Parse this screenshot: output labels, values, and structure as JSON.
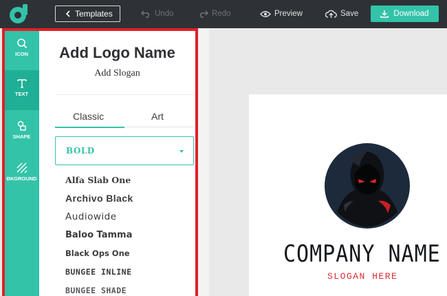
{
  "toolbar": {
    "templates_label": "Templates",
    "undo_label": "Undo",
    "redo_label": "Redo",
    "preview_label": "Preview",
    "save_label": "Save",
    "download_label": "Download"
  },
  "sidebar": {
    "items": [
      {
        "label": "ICON",
        "icon": "search-icon"
      },
      {
        "label": "TEXT",
        "icon": "text-icon"
      },
      {
        "label": "SHAPE",
        "icon": "shape-icon"
      },
      {
        "label": "BKGROUND",
        "icon": "background-icon"
      }
    ]
  },
  "panel": {
    "logo_name": "Add Logo Name",
    "slogan": "Add Slogan",
    "tabs": [
      {
        "label": "Classic"
      },
      {
        "label": "Art"
      }
    ],
    "font_category": "BOLD",
    "fonts": [
      "Alfa Slab One",
      "Archivo Black",
      "Audiowide",
      "Baloo Tamma",
      "Black Ops One",
      "BUNGEE INLINE",
      "BUNGEE SHADE"
    ]
  },
  "canvas": {
    "company_name": "COMPANY NAME",
    "slogan": "SLOGAN HERE"
  },
  "colors": {
    "accent": "#33c3a9",
    "topbar": "#2e3236",
    "highlight_frame": "#e02027",
    "slogan_red": "#e0282e"
  }
}
